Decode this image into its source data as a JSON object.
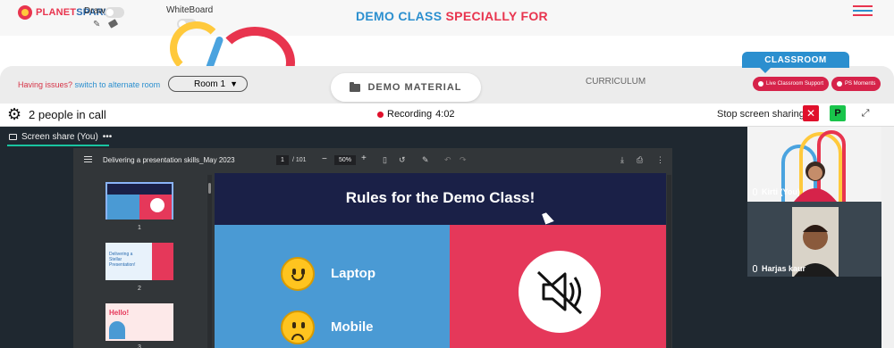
{
  "brand": {
    "logo_text_a": "PLANET",
    "logo_text_b": "SPARK"
  },
  "tools": {
    "draw_label": "Draw",
    "whiteboard_label": "WhiteBoard"
  },
  "header": {
    "title_part1": "DEMO CLASS",
    "title_part2": "SPECIALLY FOR"
  },
  "room_bar": {
    "issues_text": "Having issues?",
    "issues_link": "switch to alternate room",
    "room_select": "Room 1",
    "demo_material": "DEMO MATERIAL",
    "curriculum": "CURRICULUM",
    "classroom_tab": "CLASSROOM",
    "live_support": "Live Classroom Support",
    "ps_moments": "PS Moments"
  },
  "call": {
    "people_count": "2 people in call",
    "recording_label": "Recording",
    "recording_time": "4:02",
    "stop_share": "Stop screen sharing",
    "p_label": "P"
  },
  "share": {
    "label": "Screen share (You)",
    "more": "•••"
  },
  "pdf": {
    "filename": "Delivering a presentation skills_May 2023",
    "page_current": "1",
    "page_total": "/ 101",
    "zoom": "50%",
    "thumb_numbers": [
      "1",
      "2",
      "3"
    ],
    "thumb2_title": "Delivering a Stellar Presentation!",
    "thumb3_title": "Hello!"
  },
  "slide": {
    "title": "Rules for the Demo Class!",
    "item1": "Laptop",
    "item2": "Mobile"
  },
  "participants": [
    {
      "name": "Kirti (You)"
    },
    {
      "name": "Harjas kaur"
    }
  ],
  "colors": {
    "brand_red": "#e8344e",
    "brand_blue": "#2b8fcf",
    "stage_bg": "#1f2830",
    "recording_red": "#e0102b"
  }
}
